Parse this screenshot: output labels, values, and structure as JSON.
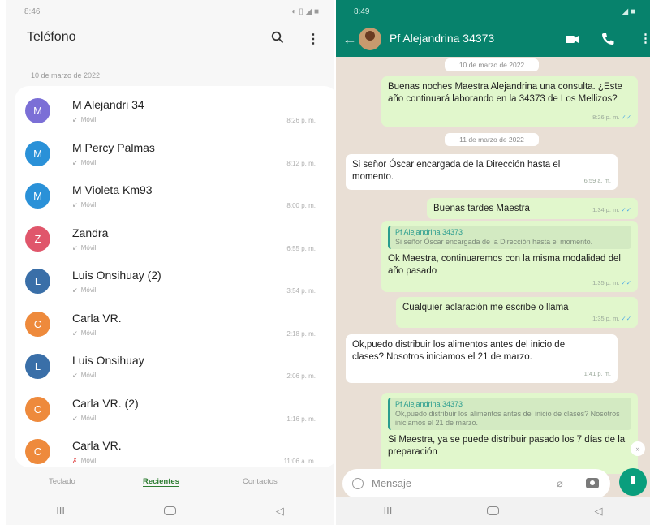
{
  "left": {
    "status": {
      "time": "8:46",
      "right": "◐ ▯ ◢ ■"
    },
    "title": "Teléfono",
    "date": "10 de marzo de 2022",
    "calls": [
      {
        "initial": "M",
        "name": "M Alejandri 34",
        "type": "Móvil",
        "time": "8:26 p. m.",
        "color": "#7b6fd6",
        "missed": false
      },
      {
        "initial": "M",
        "name": "M Percy Palmas",
        "type": "Móvil",
        "time": "8:12 p. m.",
        "color": "#2a91d8",
        "missed": false
      },
      {
        "initial": "M",
        "name": "M Violeta Km93",
        "type": "Móvil",
        "time": "8:00 p. m.",
        "color": "#2a91d8",
        "missed": false
      },
      {
        "initial": "Z",
        "name": "Zandra",
        "type": "Móvil",
        "time": "6:55 p. m.",
        "color": "#e0566b",
        "missed": false
      },
      {
        "initial": "L",
        "name": "Luis Onsihuay (2)",
        "type": "Móvil",
        "time": "3:54 p. m.",
        "color": "#3a6fa8",
        "missed": false
      },
      {
        "initial": "C",
        "name": "Carla VR.",
        "type": "Móvil",
        "time": "2:18 p. m.",
        "color": "#ee8a3c",
        "missed": false
      },
      {
        "initial": "L",
        "name": "Luis Onsihuay",
        "type": "Móvil",
        "time": "2:06 p. m.",
        "color": "#3a6fa8",
        "missed": false
      },
      {
        "initial": "C",
        "name": "Carla VR. (2)",
        "type": "Móvil",
        "time": "1:16 p. m.",
        "color": "#ee8a3c",
        "missed": false
      },
      {
        "initial": "C",
        "name": "Carla VR.",
        "type": "Móvil",
        "time": "11:06 a. m.",
        "color": "#ee8a3c",
        "missed": true
      }
    ],
    "tabs": [
      "Teclado",
      "Recientes",
      "Contactos"
    ],
    "nav": [
      "III",
      "◁"
    ]
  },
  "right": {
    "status": {
      "time": "8:49",
      "right": "◢ ■"
    },
    "contact": "Pf Alejandrina 34373",
    "pill1": "10 de marzo de 2022",
    "pill2": "11 de marzo de 2022",
    "messages": [
      {
        "text": "Buenas noches Maestra Alejandrina una consulta. ¿Este año continuará laborando en la 34373 de Los Mellizos?",
        "time": "8:26 p. m."
      },
      {
        "text": "Si señor Óscar encargada de la Dirección hasta el momento.",
        "time": "6:59 a. m."
      },
      {
        "text": "Buenas tardes Maestra",
        "time": "1:34 p. m."
      },
      {
        "quote_author": "Pf Alejandrina 34373",
        "quote_text": "Si señor Óscar encargada de la Dirección hasta el momento.",
        "text": "Ok Maestra, continuaremos con la misma modalidad del año pasado",
        "time": "1:35 p. m."
      },
      {
        "text": "Cualquier aclaración me escribe o llama",
        "time": "1:35 p. m."
      },
      {
        "text": "Ok,puedo distribuir los alimentos antes del inicio de  clases? Nosotros iniciamos el 21 de marzo.",
        "time": "1:41 p. m."
      },
      {
        "quote_author": "Pf Alejandrina 34373",
        "quote_text": "Ok,puedo distribuir los alimentos antes del inicio de  clases? Nosotros iniciamos el 21 de marzo.",
        "text": "Si Maestra, ya se puede distribuir pasado los 7 días de la preparación",
        "time": ""
      }
    ],
    "placeholder": "Mensaje",
    "nav": [
      "III",
      "◁"
    ]
  }
}
